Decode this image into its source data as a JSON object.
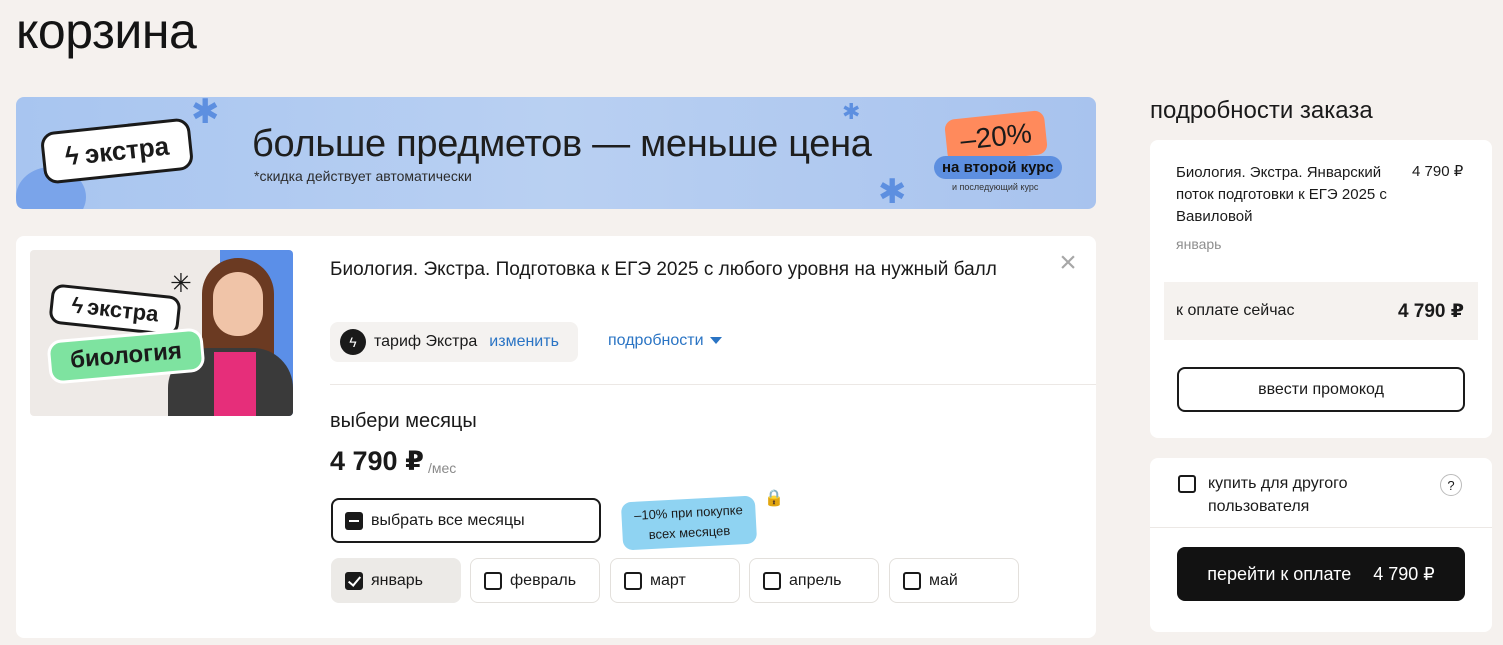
{
  "page_title": "корзина",
  "banner": {
    "badge_label": "экстра",
    "headline": "больше предметов — меньше цена",
    "subtext": "*скидка действует автоматически",
    "discount": "–20%",
    "discount_label": "на второй курс",
    "discount_note": "и последующий курс",
    "accent_color": "#a8c5f0"
  },
  "course": {
    "thumb_badge": "экстра",
    "thumb_subject": "биология",
    "title": "Биология. Экстра. Подготовка к ЕГЭ 2025 с любого уровня на нужный балл",
    "tariff_label": "тариф Экстра",
    "change_label": "изменить",
    "details_label": "подробности",
    "months_title": "выбери месяцы",
    "price": "4 790 ₽",
    "price_unit": "/мес",
    "select_all_label": "выбрать все месяцы",
    "promo_sticker_line1": "–10% при покупке",
    "promo_sticker_line2": "всех месяцев",
    "months": [
      {
        "label": "январь",
        "checked": true
      },
      {
        "label": "февраль",
        "checked": false
      },
      {
        "label": "март",
        "checked": false
      },
      {
        "label": "апрель",
        "checked": false
      },
      {
        "label": "май",
        "checked": false
      }
    ]
  },
  "summary": {
    "title": "подробности заказа",
    "item_name": "Биология. Экстра. Январский поток подготовки к ЕГЭ 2025 с Вавиловой",
    "item_price": "4 790 ₽",
    "item_month": "январь",
    "pay_now_label": "к оплате сейчас",
    "pay_now_amount": "4 790 ₽",
    "promo_button": "ввести промокод"
  },
  "checkout": {
    "gift_label_line1": "купить для другого",
    "gift_label_line2": "пользователя",
    "help": "?",
    "pay_label": "перейти к оплате",
    "pay_amount": "4 790 ₽"
  }
}
